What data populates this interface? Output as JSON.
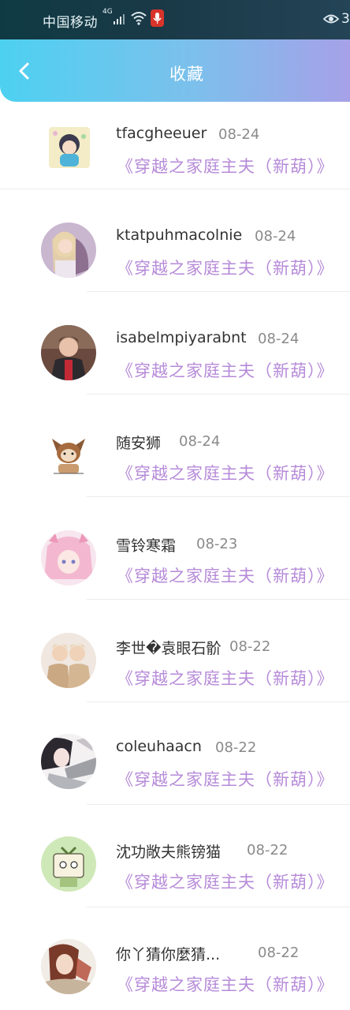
{
  "status_bar": {
    "carrier": "中国移动",
    "network": "4G",
    "battery_text": "3"
  },
  "header": {
    "title": "收藏",
    "back_icon": "chevron-left-icon"
  },
  "favorites": [
    {
      "user": "tfacgheeuer",
      "date": "08-24",
      "book": "《穿越之家庭主夫（新葫）》"
    },
    {
      "user": "ktatpuhmacolnie",
      "date": "08-24",
      "book": "《穿越之家庭主夫（新葫）》"
    },
    {
      "user": "isabelmpiyarabnt",
      "date": "08-24",
      "book": "《穿越之家庭主夫（新葫）》"
    },
    {
      "user": "随安狮",
      "date": "08-24",
      "book": "《穿越之家庭主夫（新葫）》"
    },
    {
      "user": "雪铃寒霜",
      "date": "08-23",
      "book": "《穿越之家庭主夫（新葫）》"
    },
    {
      "user": "李世�袁眼石骱",
      "date": "08-22",
      "book": "《穿越之家庭主夫（新葫）》"
    },
    {
      "user": "coleuhaacn",
      "date": "08-22",
      "book": "《穿越之家庭主夫（新葫）》"
    },
    {
      "user": "沈功敞夫熊镑猫",
      "date": "08-22",
      "book": "《穿越之家庭主夫（新葫）》"
    },
    {
      "user": "你丫猜你麼猜...",
      "date": "08-22",
      "book": "《穿越之家庭主夫（新葫）》"
    }
  ],
  "colors": {
    "header_gradient_start": "#4dd1f1",
    "header_gradient_end": "#a6a1e8",
    "book_title": "#b68ad8"
  }
}
